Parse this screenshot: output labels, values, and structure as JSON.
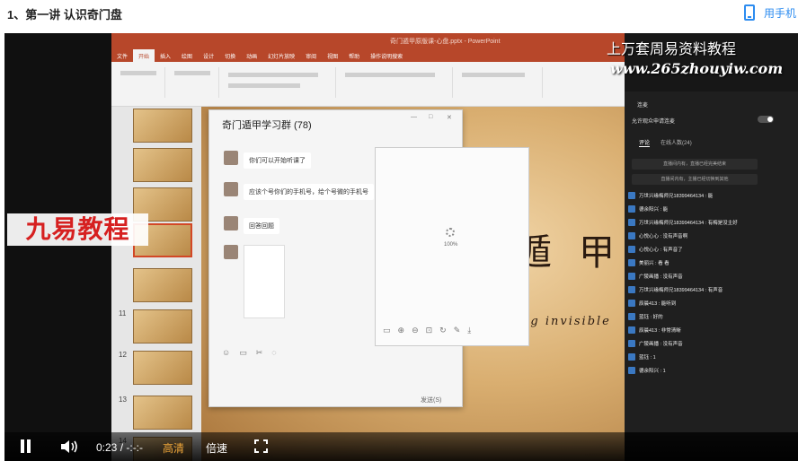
{
  "header": {
    "lesson_title": "1、第一讲 认识奇门盘",
    "mobile_link": "用手机"
  },
  "ppt": {
    "window_title": "奇门遁甲原版课-心盘.pptx - PowerPoint",
    "tabs": [
      "文件",
      "开始",
      "插入",
      "绘图",
      "设计",
      "切换",
      "动画",
      "幻灯片放映",
      "审阅",
      "视图",
      "帮助",
      "操作说明搜索"
    ],
    "active_tab": "开始",
    "slide_numbers": [
      "11",
      "12",
      "13",
      "14"
    ],
    "slide_sub": "ng invisible",
    "slide_chars": [
      "遁",
      "甲"
    ]
  },
  "chat": {
    "title": "奇门遁甲学习群 (78)",
    "messages": [
      {
        "text": "你们可以开始听课了"
      },
      {
        "text": "应该个号你们的手机号，给个号微的手机号"
      },
      {
        "text": "回答回题"
      }
    ],
    "send_label": "发送(S)"
  },
  "viewer": {
    "percent": "100%"
  },
  "panel": {
    "connect_label": "连麦",
    "allow_label": "允许观众申请连麦",
    "tabs": [
      "评论",
      "在线人数(24)"
    ],
    "notices": [
      "直播间内有，直播已经完美结束",
      "直播间内有，主播已经切换到其他"
    ],
    "comments": [
      "万世兴缘梅师兄18399464134 : 能",
      "德余阳兴 : 能",
      "万世兴缘梅师兄18399464134 : 有梅是没主好",
      "心悦心心 : 没有声音啊",
      "心悦心心 : 有声音了",
      "美丽兴 : 看 看",
      "广陵画播 : 没有声音",
      "万世兴缘梅师兄18399464134 : 有声音",
      "辰晨413 : 能听到",
      "蓝钰 : 好的",
      "辰晨413 : 非常清晰",
      "广陵画播 : 没有声音",
      "蓝钰 : 1",
      "德余阳兴 : 1"
    ]
  },
  "watermark": {
    "title": "上万套周易资料教程",
    "url": "www.265zhouyiw.com"
  },
  "logo_text": "九易教程",
  "player": {
    "time": "0:23 / -:-:-",
    "quality": "高清",
    "speed": "倍速"
  }
}
